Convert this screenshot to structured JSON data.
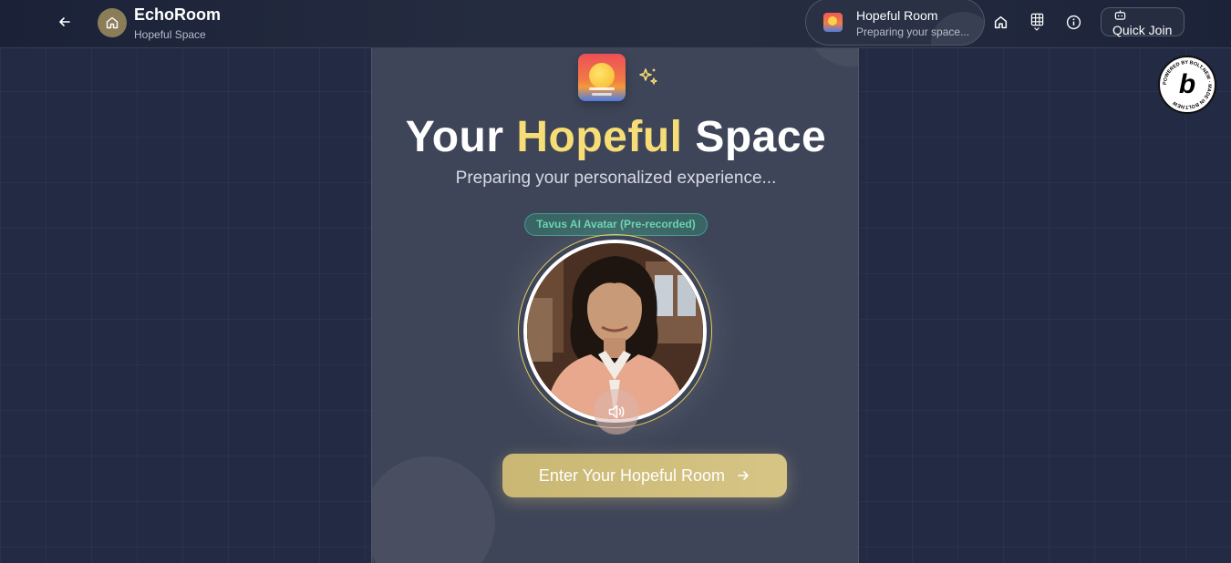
{
  "header": {
    "app_title": "EchoRoom",
    "app_subtitle": "Hopeful Space",
    "room_pill": {
      "title": "Hopeful Room",
      "subtitle": "Preparing your space..."
    },
    "quick_join_label": "Quick Join"
  },
  "main": {
    "headline_prefix": "Your ",
    "headline_accent": "Hopeful",
    "headline_suffix": " Space",
    "subtitle": "Preparing your personalized experience...",
    "avatar_badge": "Tavus AI Avatar (Pre-recorded)",
    "enter_button_label": "Enter Your Hopeful Room"
  },
  "badge": {
    "text": "POWERED BY BOLT.NEW · MADE IN BOLT.NEW",
    "glyph": "b"
  },
  "colors": {
    "accent_gold": "#f7dd75",
    "background": "#222a44",
    "card": "#3e4558",
    "badge_green": "#66d6ad"
  },
  "icons": [
    "arrow-left-icon",
    "home-icon",
    "grid-icon",
    "info-icon",
    "bot-icon",
    "sparkles-icon",
    "volume-icon",
    "arrow-right-icon"
  ]
}
